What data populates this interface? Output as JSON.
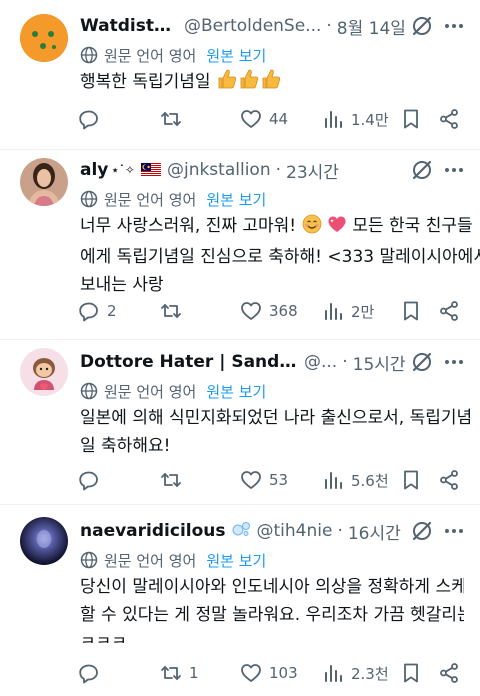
{
  "tweets": [
    {
      "name": "Watdisto...",
      "handle": "@BertoldenSe...",
      "time": "8월 14일",
      "translate_label": "원문 언어 영어",
      "translate_show": "원본 보기",
      "text": "행복한 독립기념일",
      "emoji": "thumbs-up ×3",
      "reply_count": "",
      "retweet_count": "",
      "like_count": "44",
      "view_count": "1.4만"
    },
    {
      "name": "aly",
      "name_decor": "⋆˙✧",
      "handle": "@jnkstallion",
      "time": "23시간",
      "translate_label": "원문 언어 영어",
      "translate_show": "원본 보기",
      "text_a": "너무 사랑스러워, 진짜 고마워!",
      "text_b": "모든 한국 친구들",
      "text_c": "에게 독립기념일 진심으로 축하해! <333 말레이시아에서",
      "text_d": "보내는 사랑",
      "reply_count": "2",
      "retweet_count": "",
      "like_count": "368",
      "view_count": "2만"
    },
    {
      "name": "Dottore Hater | Sandron...",
      "handle": "@...",
      "time": "15시간",
      "translate_label": "원문 언어 영어",
      "translate_show": "원본 보기",
      "text_a": "일본에 의해 식민지화되었던 나라 출신으로서, 독립기념",
      "text_b": "일 축하해요!",
      "reply_count": "",
      "retweet_count": "",
      "like_count": "53",
      "view_count": "5.6천"
    },
    {
      "name": "naevaridicilous",
      "handle": "@tih4nie",
      "time": "16시간",
      "translate_label": "원문 언어 영어",
      "translate_show": "원본 보기",
      "text_a": "당신이 말레이시아와 인도네시아 의상을 정확하게 스케치",
      "text_b": "할 수 있다는 게 정말 놀라워요. 우리조차 가끔 헷갈리는데",
      "text_c": "ㅋㅋㅋ",
      "reply_count": "",
      "retweet_count": "1",
      "like_count": "103",
      "view_count": "2.3천"
    }
  ],
  "colors": {
    "text": "#0f1419",
    "secondary": "#536471",
    "link": "#1d9bf0",
    "divider": "#eff3f4"
  }
}
